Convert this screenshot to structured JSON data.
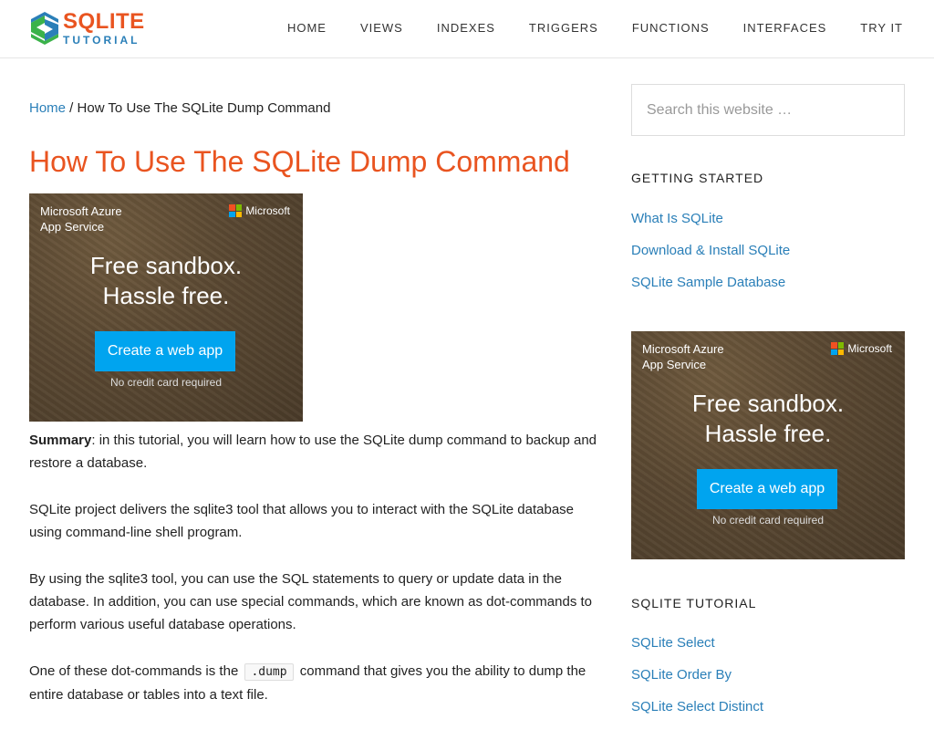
{
  "site": {
    "logo_top": "SQLITE",
    "logo_bottom": "TUTORIAL"
  },
  "nav": [
    "HOME",
    "VIEWS",
    "INDEXES",
    "TRIGGERS",
    "FUNCTIONS",
    "INTERFACES",
    "TRY IT"
  ],
  "breadcrumb": {
    "home": "Home",
    "separator": " / ",
    "current": "How To Use The SQLite Dump Command"
  },
  "page_title": "How To Use The SQLite Dump Command",
  "ad": {
    "brand_line1": "Microsoft Azure",
    "brand_line2": "App Service",
    "ms_label": "Microsoft",
    "headline1": "Free sandbox.",
    "headline2": "Hassle free.",
    "button": "Create a web app",
    "note": "No credit card required"
  },
  "content": {
    "p1_bold": "Summary",
    "p1_rest": ": in this tutorial, you will learn how to use the SQLite dump command to backup and restore a database.",
    "p2": "SQLite project delivers the sqlite3 tool that allows you to interact with the SQLite database using command-line shell program.",
    "p3": "By using the sqlite3 tool, you can use the SQL statements to query or update data in the database. In addition, you can use special commands, which are known as dot-commands to perform various useful database operations.",
    "p4_before": "One of these dot-commands is the ",
    "p4_code": ".dump",
    "p4_after": " command that gives you the ability to dump the entire database or tables into a text file."
  },
  "sidebar": {
    "search_placeholder": "Search this website …",
    "getting_started": {
      "title": "GETTING STARTED",
      "links": [
        "What Is SQLite",
        "Download & Install SQLite",
        "SQLite Sample Database"
      ]
    },
    "tutorial": {
      "title": "SQLITE TUTORIAL",
      "links": [
        "SQLite Select",
        "SQLite Order By",
        "SQLite Select Distinct"
      ]
    }
  },
  "colors": {
    "accent": "#e95420",
    "link": "#2a7fb8",
    "ad_button": "#00a4ef"
  }
}
